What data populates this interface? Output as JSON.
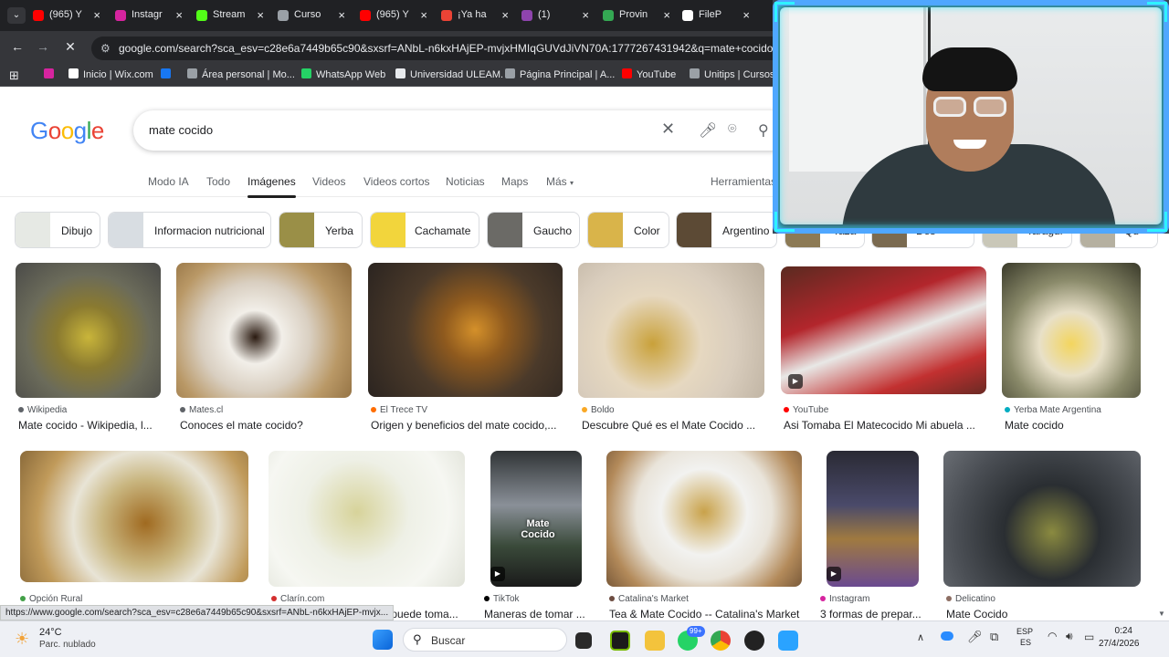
{
  "browser": {
    "tabs": [
      {
        "label": "(965) Y",
        "color": "#ff0000"
      },
      {
        "label": "Instagr",
        "color": "#d6249f"
      },
      {
        "label": "Stream",
        "color": "#53fc18"
      },
      {
        "label": "Curso",
        "color": "#9aa0a6"
      },
      {
        "label": "(965) Y",
        "color": "#ff0000"
      },
      {
        "label": "¡Ya ha",
        "color": "#ea4335"
      },
      {
        "label": "(1)",
        "color": "#8e44ad"
      },
      {
        "label": "Provin",
        "color": "#34a853"
      },
      {
        "label": "FileP",
        "color": "#ffffff"
      }
    ],
    "url": "google.com/search?sca_esv=c28e6a7449b65c90&sxsrf=ANbL-n6kxHAjEP-mvjxHMIqGUVdJiVN70A:1777267431942&q=mate+cocido&sour",
    "bookmarks": [
      {
        "label": "",
        "color": "#d6249f"
      },
      {
        "label": "Inicio | Wix.com",
        "color": "#ffffff"
      },
      {
        "label": "",
        "color": "#1877f2"
      },
      {
        "label": "Área personal | Mo...",
        "color": "#9aa0a6"
      },
      {
        "label": "WhatsApp Web",
        "color": "#25d366"
      },
      {
        "label": "Universidad ULEAM.",
        "color": "#e8eaed"
      },
      {
        "label": "Página Principal | A...",
        "color": "#9aa0a6"
      },
      {
        "label": "YouTube",
        "color": "#ff0000"
      },
      {
        "label": "Unitips | Cursos pa",
        "color": "#9aa0a6"
      }
    ]
  },
  "google": {
    "logo": "Google",
    "query": "mate cocido",
    "tabs": [
      "Modo IA",
      "Todo",
      "Imágenes",
      "Videos",
      "Videos cortos",
      "Noticias",
      "Maps",
      "Más"
    ],
    "active_tab": "Imágenes",
    "tools": "Herramientas",
    "chips": [
      "Dibujo",
      "Informacion nutricional",
      "Yerba",
      "Cachamate",
      "Gaucho",
      "Color",
      "Argentino",
      "Taza",
      "Des",
      "Taragui",
      "Qu"
    ],
    "results_row1": [
      {
        "source": "Wikipedia",
        "title": "Mate cocido - Wikipedia, l...",
        "color": "#5f6368"
      },
      {
        "source": "Mates.cl",
        "title": "Conoces el mate cocido?",
        "color": "#5f6368"
      },
      {
        "source": "El Trece TV",
        "title": "Origen y beneficios del mate cocido,...",
        "color": "#ff6d00"
      },
      {
        "source": "Boldo",
        "title": "Descubre Qué es el Mate Cocido ...",
        "color": "#f9a825"
      },
      {
        "source": "YouTube",
        "title": "Asi Tomaba El Matecocido Mi abuela ...",
        "color": "#ff0000"
      },
      {
        "source": "Yerba Mate Argentina",
        "title": "Mate cocido",
        "color": "#00acc1"
      }
    ],
    "results_row2": [
      {
        "source": "Opción Rural",
        "title": "",
        "color": "#43a047"
      },
      {
        "source": "Clarín.com",
        "title": "... puede toma...",
        "color": "#d32f2f"
      },
      {
        "source": "TikTok",
        "title": "Maneras de tomar ...",
        "color": "#000000"
      },
      {
        "source": "Catalina's Market",
        "title": "Tea & Mate Cocido -- Catalina's Market",
        "color": "#6d4c41"
      },
      {
        "source": "Instagram",
        "title": "3 formas de prepar...",
        "color": "#d6249f"
      },
      {
        "source": "Delicatino",
        "title": "Mate Cocido",
        "color": "#8d6e63"
      }
    ],
    "overlay_text": "Mate Cocido"
  },
  "status_url": "https://www.google.com/search?sca_esv=c28e6a7449b65c90&sxsrf=ANbL-n6kxHAjEP-mvjx...",
  "taskbar": {
    "weather_temp": "24°C",
    "weather_desc": "Parc. nublado",
    "search_placeholder": "Buscar",
    "badge": "99+",
    "lang1": "ESP",
    "lang2": "ES",
    "time": "0:24",
    "date": "27/4/2026"
  }
}
